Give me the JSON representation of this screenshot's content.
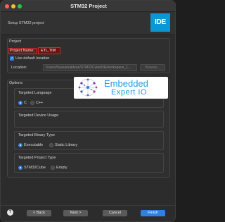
{
  "window": {
    "title": "STM32 Project"
  },
  "header": {
    "text": "Setup STM32 project",
    "logo": "IDE"
  },
  "project": {
    "group_label": "Project",
    "name_label": "Project Name:",
    "name_value": "ETI_TIM",
    "use_default_label": "Use default location",
    "location_label": "Location:",
    "location_value": "/Users/hussamaldean/STM32CubeIDE/workspace_1...",
    "browse_label": "Browse..."
  },
  "options": {
    "group_label": "Options",
    "language": {
      "label": "Targeted Language",
      "options": [
        "C",
        "C++"
      ],
      "selected": "C"
    },
    "device_usage": {
      "label": "Targeted Device Usage"
    },
    "binary_type": {
      "label": "Targeted Binary Type",
      "options": [
        "Executable",
        "Static Library"
      ],
      "selected": "Executable"
    },
    "project_type": {
      "label": "Targeted Project Type",
      "options": [
        "STM32Cube",
        "Empty"
      ],
      "selected": "STM32Cube"
    }
  },
  "overlay": {
    "line1": "Embedded",
    "line2": "Expert IO"
  },
  "footer": {
    "help": "?",
    "back": "< Back",
    "next": "Next >",
    "cancel": "Cancel",
    "finish": "Finish"
  },
  "colors": {
    "accent": "#2f7fe4",
    "error": "#d8262b",
    "logo": "#0a97d6"
  }
}
